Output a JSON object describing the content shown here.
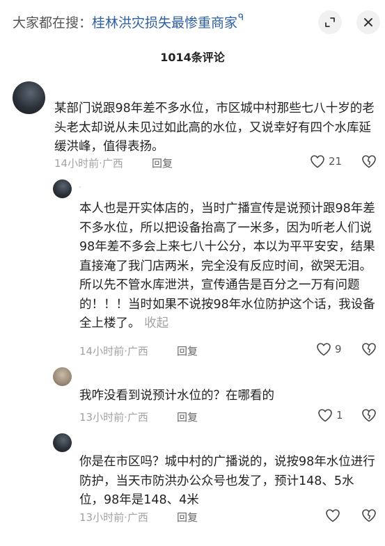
{
  "header": {
    "search_prefix": "大家都在搜：",
    "search_keyword": "桂林洪灾损失最惨重商家",
    "search_glyph": "ᑫ",
    "comment_count": "1014条评论"
  },
  "comments": [
    {
      "text": "某部门说跟98年差不多水位，市区城中村那些七八十岁的老头老太却说从未见过如此高的水位，又说幸好有四个水库延缓洪峰，值得表扬。",
      "time": "14小时前·广西",
      "reply_label": "回复",
      "likes": "21"
    },
    {
      "username": "·",
      "text": "本人也是开实体店的，当时广播宣传是说预计跟98年差不多水位，所以把设备抬高了一米多，因为听老人们说98年差不多会上来七八十公分，本以为平平安安，结果直接淹了我门店两米，完全没有反应时间，欲哭无泪。所以先不管水库泄洪，宣传通告是百分之一万有问题的！！！当时如果不说按98年水位防护这个话，我设备全上楼了。",
      "collapse_label": "收起",
      "time": "14小时前·广西",
      "reply_label": "回复",
      "likes": "9"
    },
    {
      "text": "我咋没看到说预计水位的？在哪看的",
      "time": "13小时前·广西",
      "reply_label": "回复",
      "likes": "1"
    },
    {
      "text": "你是在市区吗？城中村的广播说的，说按98年水位进行防护，当天市防洪办公众号也发了，预计148、5水位，98年是148、4米",
      "time": "13小时前·广西",
      "reply_label": "回复",
      "likes": ""
    }
  ],
  "colors": {
    "keyword": "#2d5fa3",
    "meta": "#a3a3a3",
    "text": "#222222"
  },
  "icons": [
    "expand-icon",
    "close-icon",
    "heart-icon",
    "dislike-icon"
  ]
}
